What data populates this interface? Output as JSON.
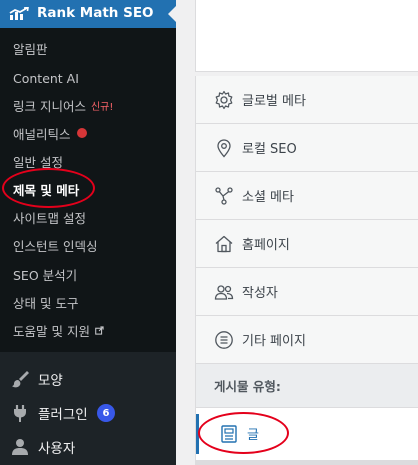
{
  "sidebar": {
    "header": {
      "label": "Rank Math SEO",
      "icon": "rank-math-chart-icon"
    },
    "submenu": [
      {
        "label": "알림판"
      },
      {
        "label": "Content AI"
      },
      {
        "label": "링크 지니어스",
        "badge": "신규!"
      },
      {
        "label": "애널리틱스",
        "dot": true
      },
      {
        "label": "일반 설정"
      },
      {
        "label": "제목 및 메타",
        "current": true
      },
      {
        "label": "사이트맵 설정"
      },
      {
        "label": "인스턴트 인덱싱"
      },
      {
        "label": "SEO 분석기"
      },
      {
        "label": "상태 및 도구"
      },
      {
        "label": "도움말 및 지원",
        "external": true
      }
    ],
    "menu": [
      {
        "label": "모양",
        "icon": "paintbrush-icon"
      },
      {
        "label": "플러그인",
        "icon": "plugin-icon",
        "count": "6"
      },
      {
        "label": "사용자",
        "icon": "user-icon"
      }
    ]
  },
  "settings_nav": {
    "items": [
      {
        "label": "글로벌 메타",
        "icon": "gear-icon"
      },
      {
        "label": "로컬 SEO",
        "icon": "location-pin-icon"
      },
      {
        "label": "소셜 메타",
        "icon": "share-nodes-icon"
      },
      {
        "label": "홈페이지",
        "icon": "home-icon"
      },
      {
        "label": "작성자",
        "icon": "users-icon"
      },
      {
        "label": "기타 페이지",
        "icon": "list-circle-icon"
      }
    ],
    "section_label": "게시물 유형:",
    "active_item": {
      "label": "글",
      "icon": "post-document-icon"
    }
  },
  "colors": {
    "sidebar_bg": "#1d2327",
    "submenu_bg": "#101517",
    "accent": "#2271b1",
    "annotation_red": "#e4001b",
    "badge_blue": "#3858e9"
  }
}
